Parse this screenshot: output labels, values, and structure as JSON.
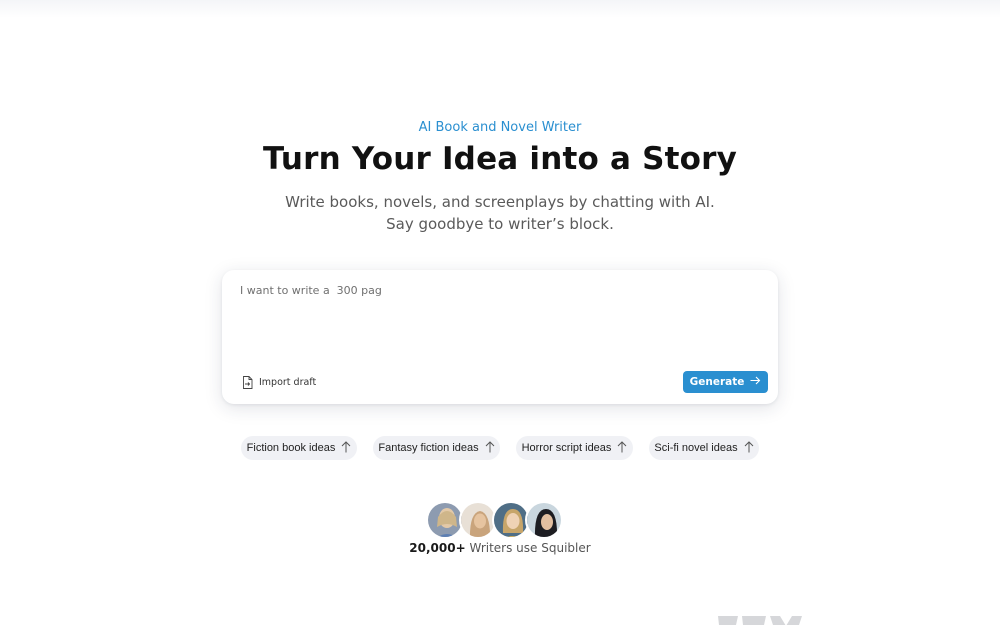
{
  "hero": {
    "eyebrow": "AI Book and Novel Writer",
    "title": "Turn Your Idea into a Story",
    "subtitle": "Write books, novels, and screenplays by chatting with AI. Say goodbye to writer’s block."
  },
  "composer": {
    "input_value": "I want to write a  300 pag",
    "import_label": "Import draft",
    "import_icon": "file-import-icon",
    "generate_label": "Generate",
    "generate_icon": "arrow-right-icon"
  },
  "suggestions": [
    {
      "label": "Fiction book ideas",
      "icon": "arrow-up-icon"
    },
    {
      "label": "Fantasy fiction ideas",
      "icon": "arrow-up-icon"
    },
    {
      "label": "Horror script ideas",
      "icon": "arrow-up-icon"
    },
    {
      "label": "Sci-fi novel ideas",
      "icon": "arrow-up-icon"
    }
  ],
  "social_proof": {
    "count": "20,000+",
    "text": "Writers use Squibler"
  },
  "colors": {
    "accent": "#2a8fd0",
    "chip_bg": "#f0f1f5",
    "headline": "#111111"
  }
}
